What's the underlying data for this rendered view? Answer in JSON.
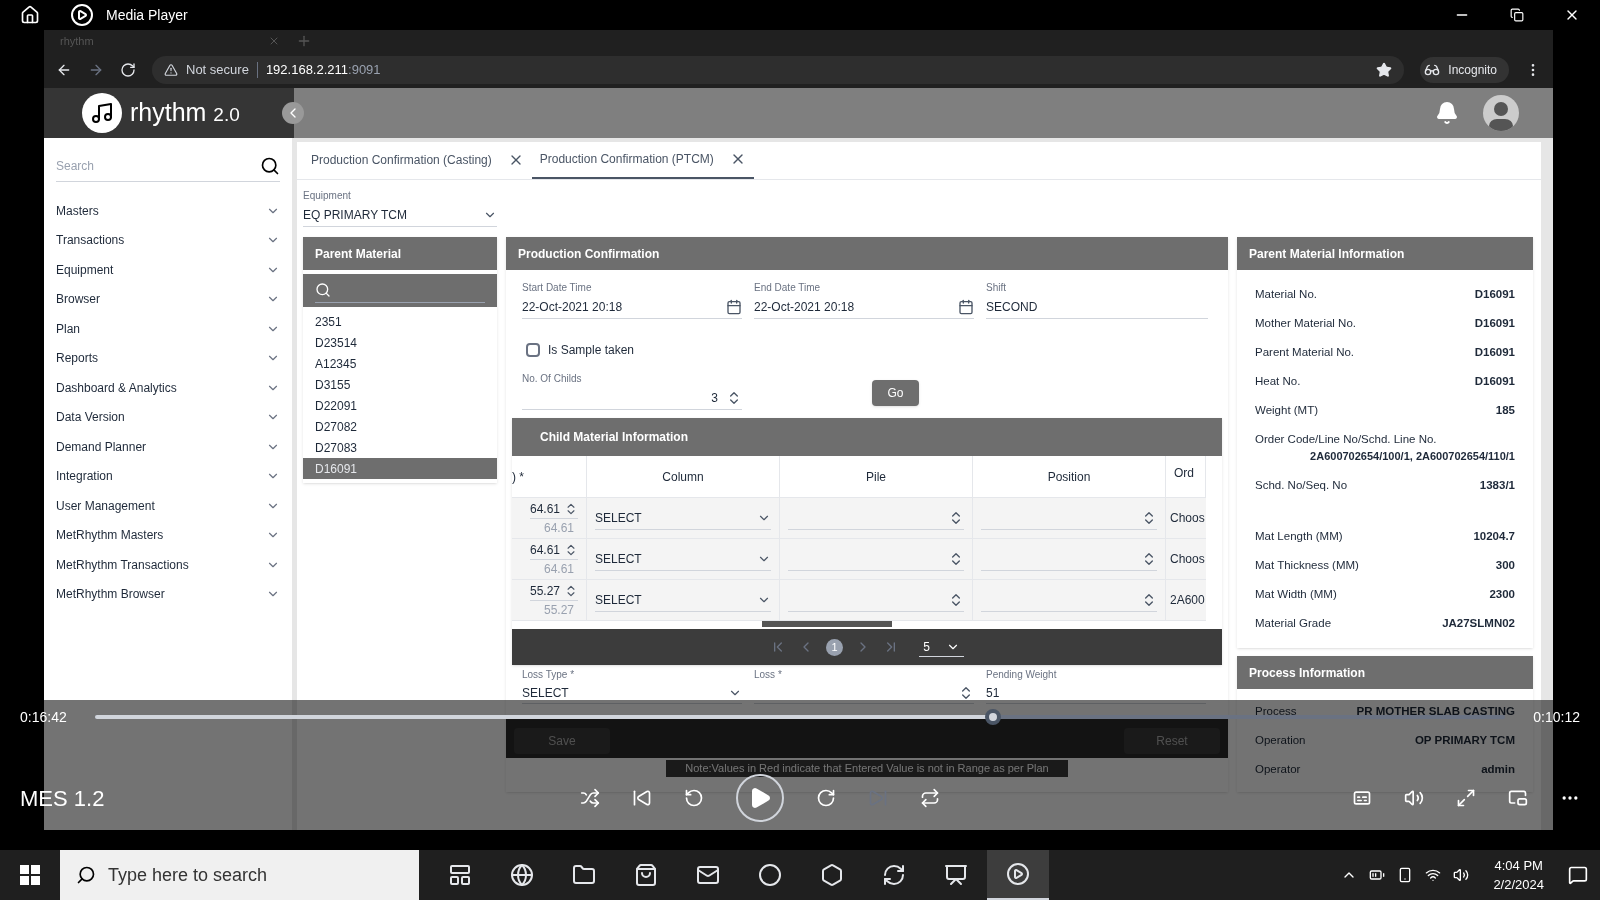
{
  "player": {
    "title": "Media Player",
    "elapsed": "0:16:42",
    "remaining": "0:10:12",
    "level": 0.637,
    "video_title": "MES 1.2"
  },
  "browser": {
    "tab": "rhythm",
    "security": "Not secure",
    "host": "192.168.2.211",
    "port": ":9091",
    "profile": "Incognito"
  },
  "app": {
    "logo": "rhythm",
    "version": "2.0"
  },
  "sidebar": {
    "search_placeholder": "Search",
    "items": [
      {
        "label": "Masters",
        "expanded": false
      },
      {
        "label": "Transactions",
        "expanded": false
      },
      {
        "label": "Equipment",
        "expanded": false
      },
      {
        "label": "Browser",
        "expanded": false
      },
      {
        "label": "Plan",
        "expanded": false
      },
      {
        "label": "Reports",
        "expanded": false
      },
      {
        "label": "Dashboard & Analytics",
        "expanded": false
      },
      {
        "label": "Data Version",
        "expanded": false
      },
      {
        "label": "Demand Planner",
        "expanded": false
      },
      {
        "label": "Integration",
        "expanded": false
      },
      {
        "label": "User Management",
        "expanded": false
      },
      {
        "label": "MetRhythm Masters",
        "expanded": false
      },
      {
        "label": "MetRhythm Transactions",
        "expanded": false
      },
      {
        "label": "MetRhythm Browser",
        "expanded": false
      }
    ]
  },
  "tabs": [
    {
      "label": "Production Confirmation (Casting)",
      "selected": false
    },
    {
      "label": "Production Confirmation (PTCM)",
      "selected": true
    }
  ],
  "equipment": {
    "label": "Equipment",
    "value": "EQ PRIMARY TCM"
  },
  "parent_material": {
    "title": "Parent Material",
    "items": [
      {
        "label": "2351",
        "selected": false
      },
      {
        "label": "D23514",
        "selected": false
      },
      {
        "label": "A12345",
        "selected": false
      },
      {
        "label": "D3155",
        "selected": false
      },
      {
        "label": "D22091",
        "selected": false
      },
      {
        "label": "D27082",
        "selected": false
      },
      {
        "label": "D27083",
        "selected": false
      },
      {
        "label": "D16091",
        "selected": true
      }
    ]
  },
  "production": {
    "title": "Production Confirmation",
    "start_label": "Start Date Time",
    "start": "22-Oct-2021 20:18",
    "end_label": "End Date Time",
    "end": "22-Oct-2021 20:18",
    "shift_label": "Shift",
    "shift": "SECOND",
    "sample": {
      "label": "Is Sample taken",
      "checked": false
    },
    "childs_label": "No. Of Childs",
    "childs": "3",
    "go": "Go"
  },
  "child_table": {
    "title": "Child Material Information",
    "columns": [
      ") *",
      "Column",
      "Pile",
      "Position",
      "Ord"
    ],
    "rows": [
      {
        "weight": "64.61",
        "planned": "64.61",
        "column": "SELECT",
        "order": "Choos"
      },
      {
        "weight": "64.61",
        "planned": "64.61",
        "column": "SELECT",
        "order": "Choos"
      },
      {
        "weight": "55.27",
        "planned": "55.27",
        "column": "SELECT",
        "order": "2A600"
      }
    ],
    "pages": [
      {
        "label": "1",
        "selected": true
      }
    ],
    "page_size": "5"
  },
  "loss": [
    {
      "label": "Loss Type *",
      "value": "SELECT",
      "kind": "select"
    },
    {
      "label": "Loss *",
      "kind": "spin"
    },
    {
      "label": "Pending Weight",
      "value": "51",
      "kind": "text"
    }
  ],
  "actions": [
    "Save",
    "Reset"
  ],
  "note": "Note:Values in Red indicate that Entered Value is not in Range as per Plan",
  "parent_info": {
    "title": "Parent Material Information",
    "rows": [
      {
        "label": "Material No.",
        "value": "D16091",
        "kind": "pair"
      },
      {
        "label": "Mother Material No.",
        "value": "D16091",
        "kind": "pair"
      },
      {
        "label": "Parent Material No.",
        "value": "D16091",
        "kind": "pair"
      },
      {
        "label": "Heat No.",
        "value": "D16091",
        "kind": "pair"
      },
      {
        "label": "Weight (MT)",
        "value": "185",
        "kind": "pair"
      },
      {
        "label": "Order Code/Line No/Schd. Line No.",
        "value": "2A600702654/100/1, 2A600702654/110/1",
        "kind": "stacked"
      },
      {
        "label": "Schd. No/Seq. No",
        "value": "1383/1",
        "kind": "pair"
      },
      {
        "label": "Mat Length (MM)",
        "value": "10204.7",
        "kind": "spaced"
      },
      {
        "label": "Mat Thickness (MM)",
        "value": "300",
        "kind": "pair"
      },
      {
        "label": "Mat Width (MM)",
        "value": "2300",
        "kind": "pair"
      },
      {
        "label": "Material Grade",
        "value": "JA27SLMN02",
        "kind": "pair"
      }
    ]
  },
  "process_info": {
    "title": "Process Information",
    "rows": [
      {
        "label": "Process",
        "value": "PR MOTHER SLAB CASTING"
      },
      {
        "label": "Operation",
        "value": "OP PRIMARY TCM"
      },
      {
        "label": "Operator",
        "value": "admin"
      }
    ]
  },
  "taskbar": {
    "search_placeholder": "Type here to search",
    "apps": [
      {
        "kind": "taskview",
        "selected": false
      },
      {
        "kind": "browser",
        "selected": false
      },
      {
        "kind": "folder",
        "selected": false
      },
      {
        "kind": "store",
        "selected": false
      },
      {
        "kind": "mail",
        "selected": false
      },
      {
        "kind": "circle",
        "selected": false
      },
      {
        "kind": "hexagon",
        "selected": false
      },
      {
        "kind": "refresh",
        "selected": false
      },
      {
        "kind": "slides",
        "selected": false
      },
      {
        "kind": "player",
        "selected": true
      }
    ],
    "time": "4:04 PM",
    "date": "2/2/2024"
  }
}
